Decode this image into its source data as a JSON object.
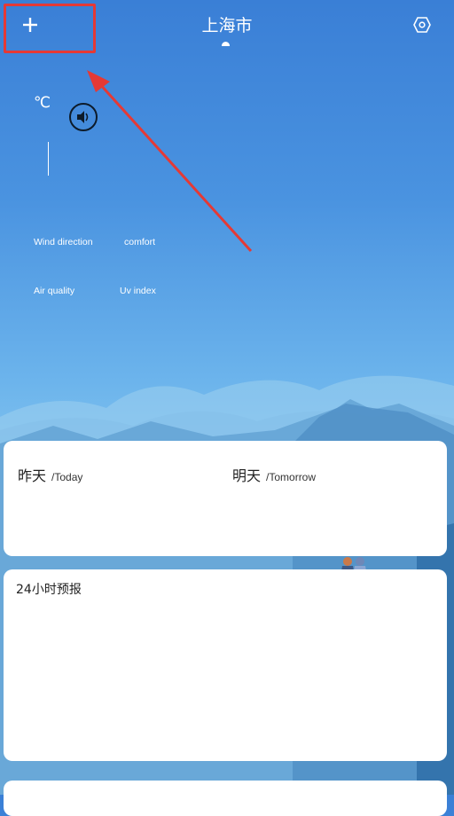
{
  "header": {
    "city": "上海市"
  },
  "weather": {
    "temperature_unit": "℃",
    "labels": {
      "wind_direction": "Wind direction",
      "comfort": "comfort",
      "air_quality": "Air quality",
      "uv_index": "Uv index"
    }
  },
  "days_card": {
    "today_cn": "昨天",
    "today_en": "/Today",
    "tomorrow_cn": "明天",
    "tomorrow_en": "/Tomorrow"
  },
  "hourly_card": {
    "title": "24小时预报"
  },
  "icons": {
    "add": "plus-icon",
    "settings": "hexagon-settings-icon",
    "speaker": "speaker-icon"
  },
  "colors": {
    "annotation": "#e53935",
    "sky_top": "#3a7fd6",
    "sky_bottom": "#89c8f0"
  }
}
